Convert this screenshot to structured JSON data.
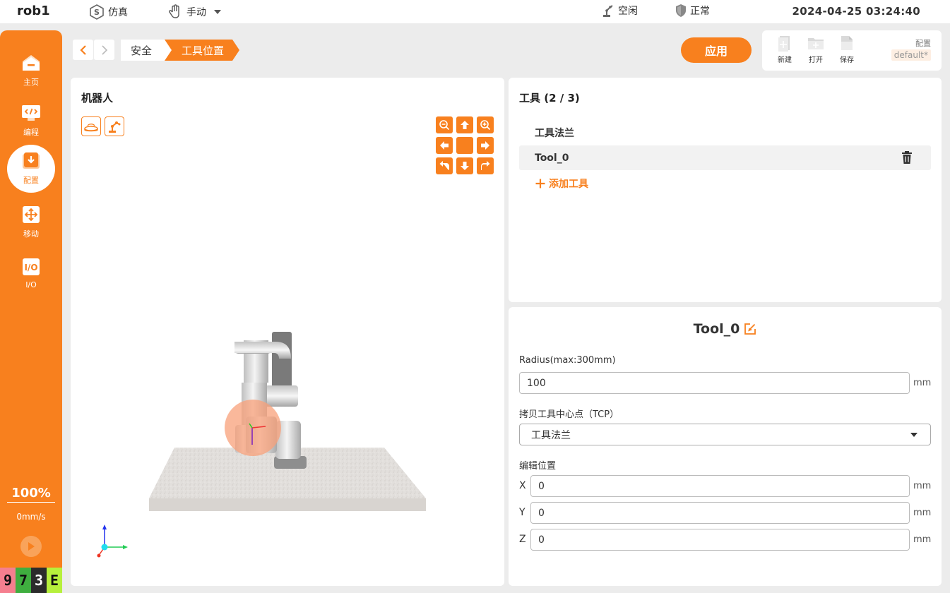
{
  "topbar": {
    "robot_name": "rob1",
    "mode_sim": "仿真",
    "mode_manual": "手动",
    "robot_state": "空闲",
    "safety_state": "正常",
    "datetime": "2024-04-25 03:24:40"
  },
  "sidebar": {
    "items": [
      {
        "label": "主页",
        "icon": "home-icon"
      },
      {
        "label": "编程",
        "icon": "code-icon"
      },
      {
        "label": "配置",
        "icon": "config-icon",
        "active": true
      },
      {
        "label": "移动",
        "icon": "move-icon"
      },
      {
        "label": "I/O",
        "icon": "io-icon"
      }
    ],
    "speed_percent": "100%",
    "speed_value": "0mm/s",
    "counters": [
      {
        "text": "9",
        "color": "#f57f8f"
      },
      {
        "text": "7",
        "color": "#3fae3f"
      },
      {
        "text": "3",
        "color": "#2b2b2b"
      },
      {
        "text": "E",
        "color": "#b6f03c"
      }
    ]
  },
  "breadcrumb": {
    "items": [
      "安全",
      "工具位置"
    ]
  },
  "toolbar": {
    "apply_label": "应用",
    "new_label": "新建",
    "open_label": "打开",
    "save_label": "保存",
    "config_label": "配置",
    "config_value": "default*"
  },
  "robot_panel": {
    "title": "机器人"
  },
  "tools_panel": {
    "title": "工具 (2 / 3)",
    "tools": [
      "工具法兰",
      "Tool_0"
    ],
    "selected_index": 1,
    "add_label": "添加工具"
  },
  "detail": {
    "title": "Tool_0",
    "radius_label": "Radius(max:300mm)",
    "radius_value": "100",
    "unit": "mm",
    "copy_tcp_label": "拷贝工具中心点（TCP）",
    "copy_tcp_value": "工具法兰",
    "edit_position_label": "编辑位置",
    "x_label": "X",
    "x_value": "0",
    "y_label": "Y",
    "y_value": "0",
    "z_label": "Z",
    "z_value": "0"
  },
  "colors": {
    "accent": "#f8801e",
    "background": "#ececec"
  }
}
